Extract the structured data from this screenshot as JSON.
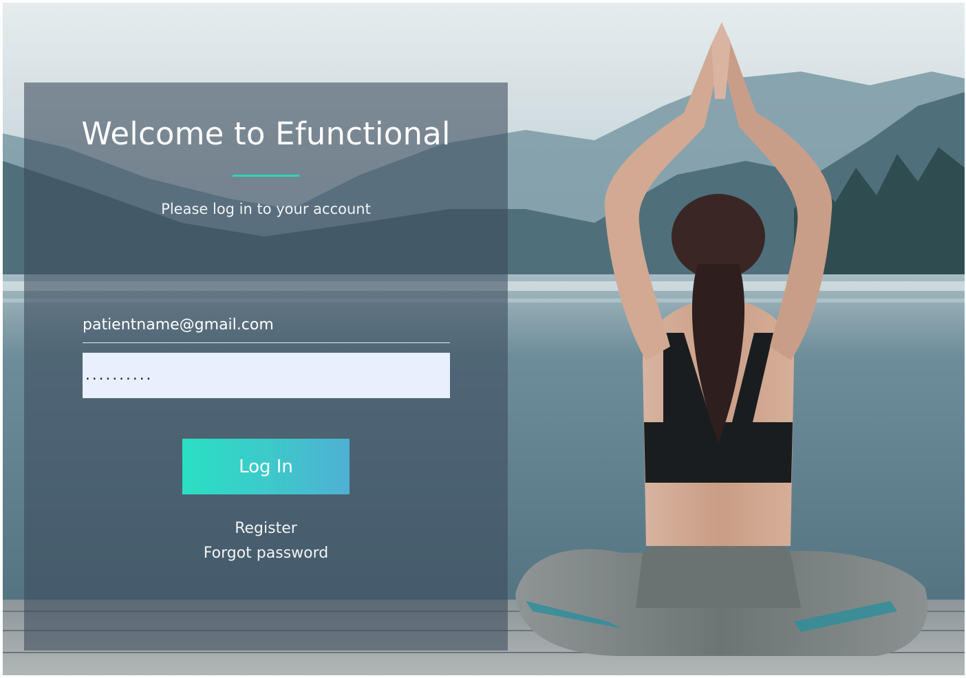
{
  "login": {
    "title": "Welcome to Efunctional",
    "subtitle": "Please log in to your account",
    "email_value": "patientname@gmail.com",
    "password_value": "..........",
    "login_label": "Log In",
    "register_label": "Register",
    "forgot_label": "Forgot password"
  },
  "colors": {
    "accent": "#2fd3bd",
    "button_start": "#2ae0c3",
    "button_end": "#4fb0d4",
    "password_fill": "#e8effd",
    "panel_overlay": "#3a4a5c"
  },
  "background": {
    "subject": "woman-doing-yoga-by-lake"
  }
}
